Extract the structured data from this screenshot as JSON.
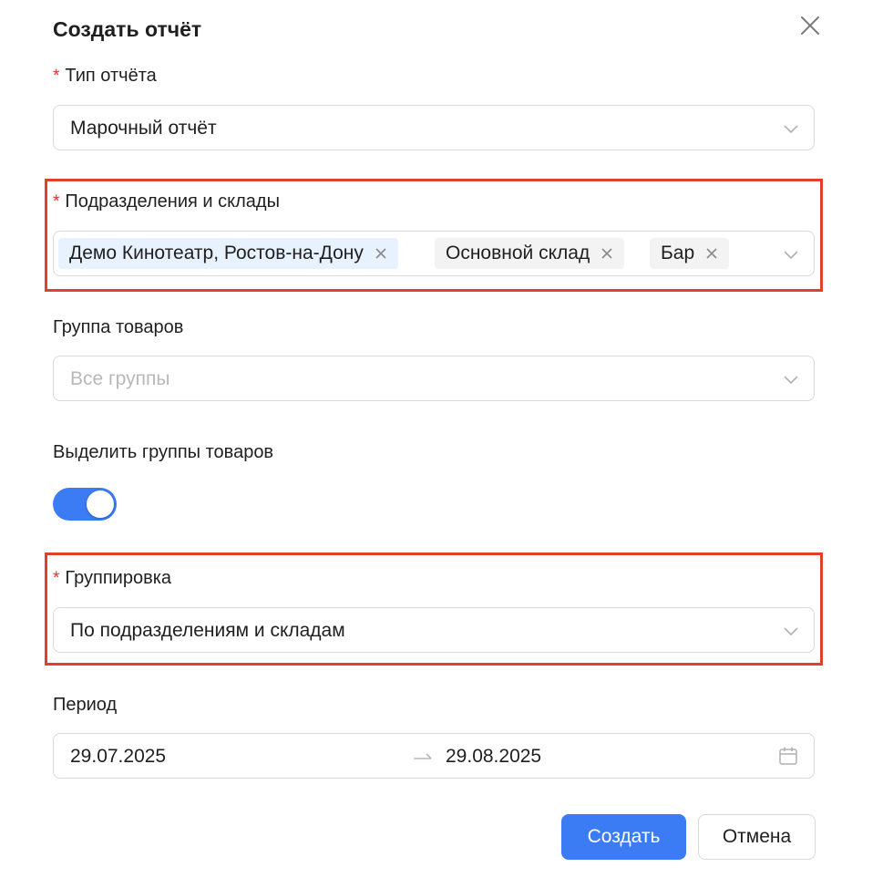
{
  "dialog": {
    "title": "Создать отчёт"
  },
  "report_type": {
    "required_mark": "*",
    "label": "Тип отчёта",
    "value": "Марочный отчёт"
  },
  "divisions": {
    "required_mark": "*",
    "label": "Подразделения и склады",
    "tags": [
      "Демо Кинотеатр, Ростов-на-Дону",
      "Основной склад",
      "Бар"
    ]
  },
  "product_group": {
    "label": "Группа товаров",
    "placeholder": "Все группы"
  },
  "highlight_groups": {
    "label": "Выделить группы товаров",
    "enabled": true
  },
  "grouping": {
    "required_mark": "*",
    "label": "Группировка",
    "value": "По подразделениям и складам"
  },
  "period": {
    "label": "Период",
    "start": "29.07.2025",
    "end": "29.08.2025"
  },
  "buttons": {
    "create": "Создать",
    "cancel": "Отмена"
  },
  "colors": {
    "primary": "#3b7cf5",
    "required": "#e5322d",
    "highlight_border": "#e0402c",
    "tag_blue": "#e8f2ff",
    "tag_gray": "#f3f3f3"
  },
  "icons": {
    "close": "close-icon",
    "chevron": "chevron-down-icon",
    "tag_remove": "tag-remove-icon",
    "range_arrow": "arrow-right-icon",
    "calendar": "calendar-icon"
  }
}
